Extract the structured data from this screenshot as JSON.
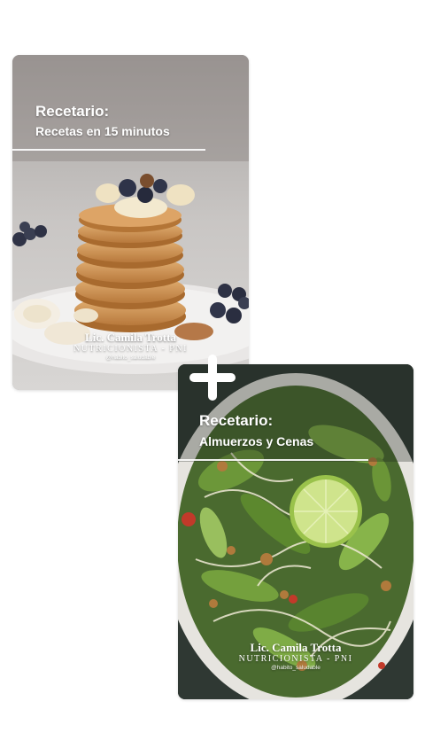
{
  "cards": [
    {
      "title": "Recetario:",
      "subtitle": "Recetas en 15 minutos",
      "brand": {
        "name": "Lic. Camila Trotta",
        "role": "NUTRICIONISTA - PNI",
        "handle": "@habito_saludable"
      },
      "image": "pancake-stack-with-blueberries-photo"
    },
    {
      "title": "Recetario:",
      "subtitle": "Almuerzos y Cenas",
      "brand": {
        "name": "Lic. Camila Trotta",
        "role": "NUTRICIONISTA - PNI",
        "handle": "@habito_saludable"
      },
      "image": "green-salad-bowl-with-lime-photo"
    }
  ],
  "plus_icon": "plus-icon",
  "colors": {
    "background": "#ffffff",
    "text": "#ffffff"
  }
}
